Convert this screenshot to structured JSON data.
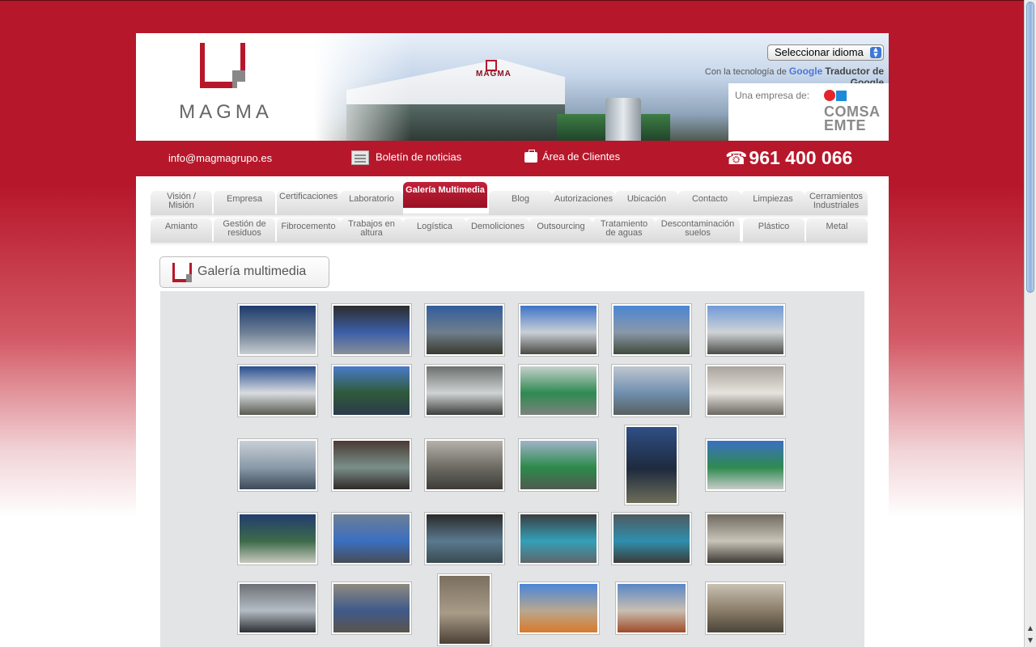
{
  "header": {
    "logo_text": "MAGMA",
    "banner_logo_text": "MAGMA",
    "language_select": "Seleccionar idioma",
    "google_prefix": "Con la tecnología de",
    "google_word": "Google",
    "google_suffix": "Traductor de Google",
    "empresa_label": "Una empresa de:",
    "comsa_line1": "COMSA",
    "comsa_line2": "EMTE"
  },
  "contact_bar": {
    "email": "info@magmagrupo.es",
    "newsletter": "Boletín de noticias",
    "clients": "Área de Clientes",
    "phone": "961 400 066"
  },
  "nav": {
    "row1": [
      {
        "label": "Visión / Misión"
      },
      {
        "label": "Empresa"
      },
      {
        "label": "Certificaciones"
      },
      {
        "label": "Laboratorio"
      },
      {
        "label": "Galería Multimedia",
        "active": true
      },
      {
        "label": "Blog"
      },
      {
        "label": "Autorizaciones"
      },
      {
        "label": "Ubicación"
      },
      {
        "label": "Contacto"
      },
      {
        "label": "Limpiezas"
      },
      {
        "label": "Cerramientos Industriales"
      }
    ],
    "row2": [
      {
        "label": "Amianto"
      },
      {
        "label": "Gestión de residuos"
      },
      {
        "label": "Fibrocemento"
      },
      {
        "label": "Trabajos en altura"
      },
      {
        "label": "Logística"
      },
      {
        "label": "Demoliciones"
      },
      {
        "label": "Outsourcing"
      },
      {
        "label": "Tratamiento de aguas"
      },
      {
        "label": "Descontaminación suelos"
      },
      {
        "label": "Plástico"
      },
      {
        "label": "Metal"
      }
    ]
  },
  "gallery": {
    "title": "Galería multimedia",
    "colors": {
      "brand_red": "#b7172a",
      "gallery_bg": "#e3e4e6"
    }
  }
}
